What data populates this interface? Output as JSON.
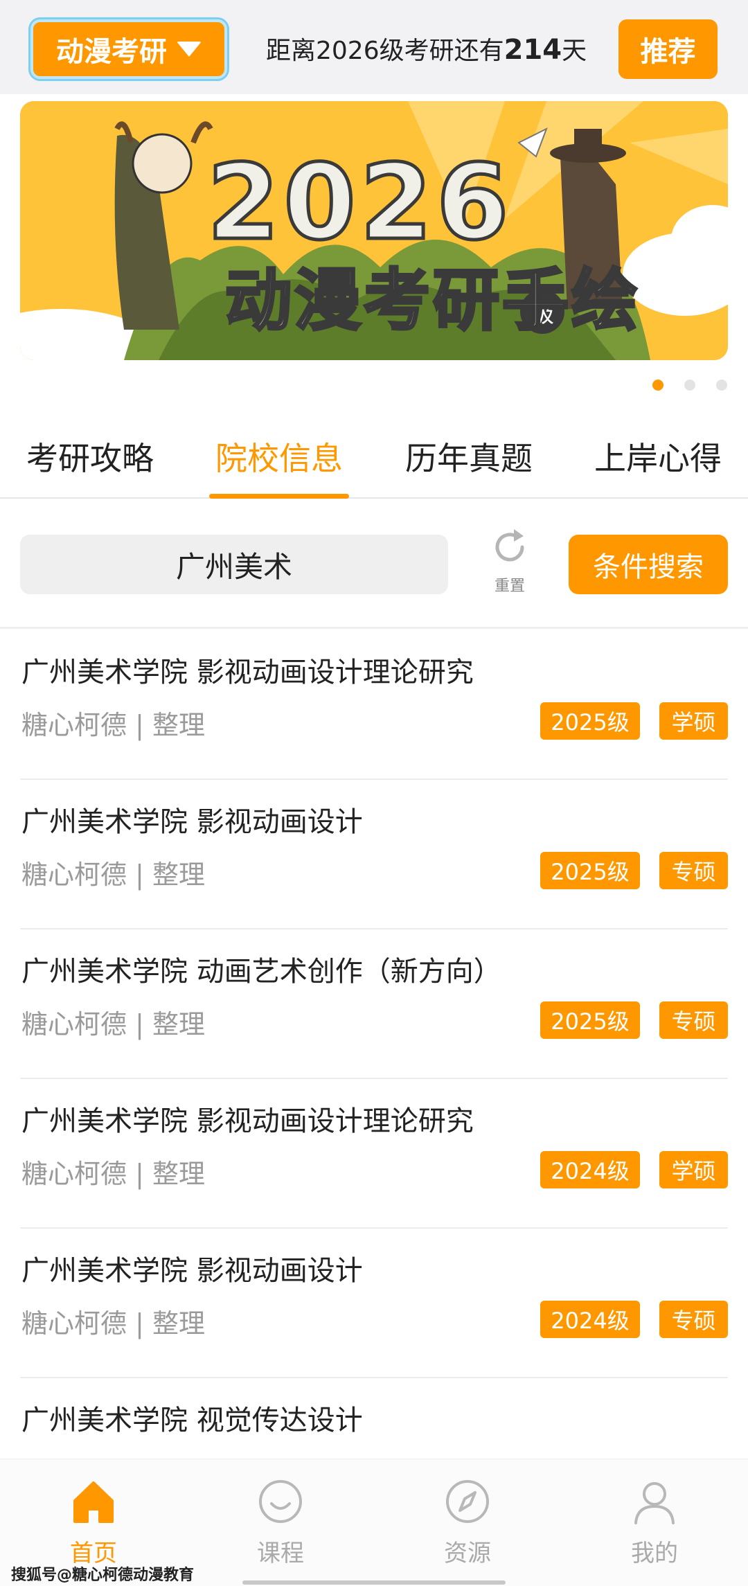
{
  "topbar": {
    "category": "动漫考研",
    "countdown_prefix": "距离2026级考研还有",
    "countdown_days": "214",
    "countdown_suffix": "天",
    "recommend_label": "推荐"
  },
  "banner": {
    "title": "2026",
    "grade_badge": "级",
    "subtitle": "动漫考研手绘",
    "slide_count": 3,
    "active_slide": 1
  },
  "tabs": [
    {
      "label": "考研攻略",
      "active": false
    },
    {
      "label": "院校信息",
      "active": true
    },
    {
      "label": "历年真题",
      "active": false
    },
    {
      "label": "上岸心得",
      "active": false
    }
  ],
  "search": {
    "value": "广州美术",
    "reset_label": "重置",
    "condition_label": "条件搜索"
  },
  "list": [
    {
      "title": "广州美术学院 影视动画设计理论研究",
      "author": "糖心柯德",
      "sep": "|",
      "note": "整理",
      "year": "2025级",
      "degree": "学硕"
    },
    {
      "title": "广州美术学院 影视动画设计",
      "author": "糖心柯德",
      "sep": "|",
      "note": "整理",
      "year": "2025级",
      "degree": "专硕"
    },
    {
      "title": "广州美术学院 动画艺术创作（新方向）",
      "author": "糖心柯德",
      "sep": "|",
      "note": "整理",
      "year": "2025级",
      "degree": "专硕"
    },
    {
      "title": "广州美术学院 影视动画设计理论研究",
      "author": "糖心柯德",
      "sep": "|",
      "note": "整理",
      "year": "2024级",
      "degree": "学硕"
    },
    {
      "title": "广州美术学院 影视动画设计",
      "author": "糖心柯德",
      "sep": "|",
      "note": "整理",
      "year": "2024级",
      "degree": "专硕"
    },
    {
      "title": "广州美术学院  视觉传达设计",
      "author": "",
      "sep": "",
      "note": "",
      "year": "",
      "degree": ""
    }
  ],
  "bottom_nav": [
    {
      "label": "首页",
      "icon": "home-icon",
      "active": true
    },
    {
      "label": "课程",
      "icon": "smile-icon",
      "active": false
    },
    {
      "label": "资源",
      "icon": "compass-icon",
      "active": false
    },
    {
      "label": "我的",
      "icon": "user-icon",
      "active": false
    }
  ],
  "watermark": "搜狐号@糖心柯德动漫教育",
  "colors": {
    "accent": "#ff9800",
    "banner_bg": "#ffc33a",
    "muted_text": "#9a9a9a"
  }
}
